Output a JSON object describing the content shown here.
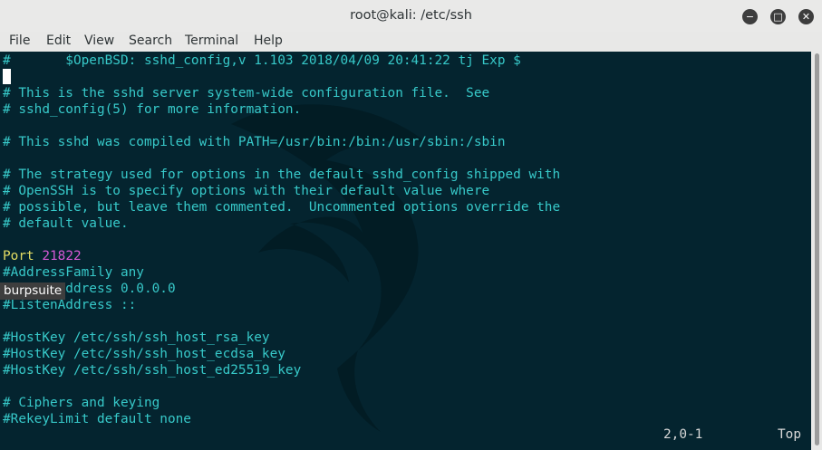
{
  "window": {
    "title": "root@kali: /etc/ssh",
    "minimize": "−",
    "maximize": "□",
    "close": "✕"
  },
  "menu": [
    "File",
    "Edit",
    "View",
    "Search",
    "Terminal",
    "Help"
  ],
  "editor": {
    "lines": [
      "#       $OpenBSD: sshd_config,v 1.103 2018/04/09 20:41:22 tj Exp $",
      "",
      "# This is the sshd server system-wide configuration file.  See",
      "# sshd_config(5) for more information.",
      "",
      "# This sshd was compiled with PATH=/usr/bin:/bin:/usr/sbin:/sbin",
      "",
      "# The strategy used for options in the default sshd_config shipped with",
      "# OpenSSH is to specify options with their default value where",
      "# possible, but leave them commented.  Uncommented options override the",
      "# default value.",
      "",
      "",
      "#AddressFamily any",
      "#ListenAddress 0.0.0.0",
      "#ListenAddress ::",
      "",
      "#HostKey /etc/ssh/ssh_host_rsa_key",
      "#HostKey /etc/ssh/ssh_host_ecdsa_key",
      "#HostKey /etc/ssh/ssh_host_ed25519_key",
      "",
      "# Ciphers and keying",
      "#RekeyLimit default none"
    ],
    "port_keyword": "Port",
    "port_value": "21822",
    "tooltip": "burpsuite",
    "status_position": "2,0-1",
    "status_scroll": "Top"
  },
  "colors": {
    "background": "#04242f",
    "comment": "#37c9c9",
    "keyword": "#e4dd63",
    "number": "#d65ad6"
  }
}
